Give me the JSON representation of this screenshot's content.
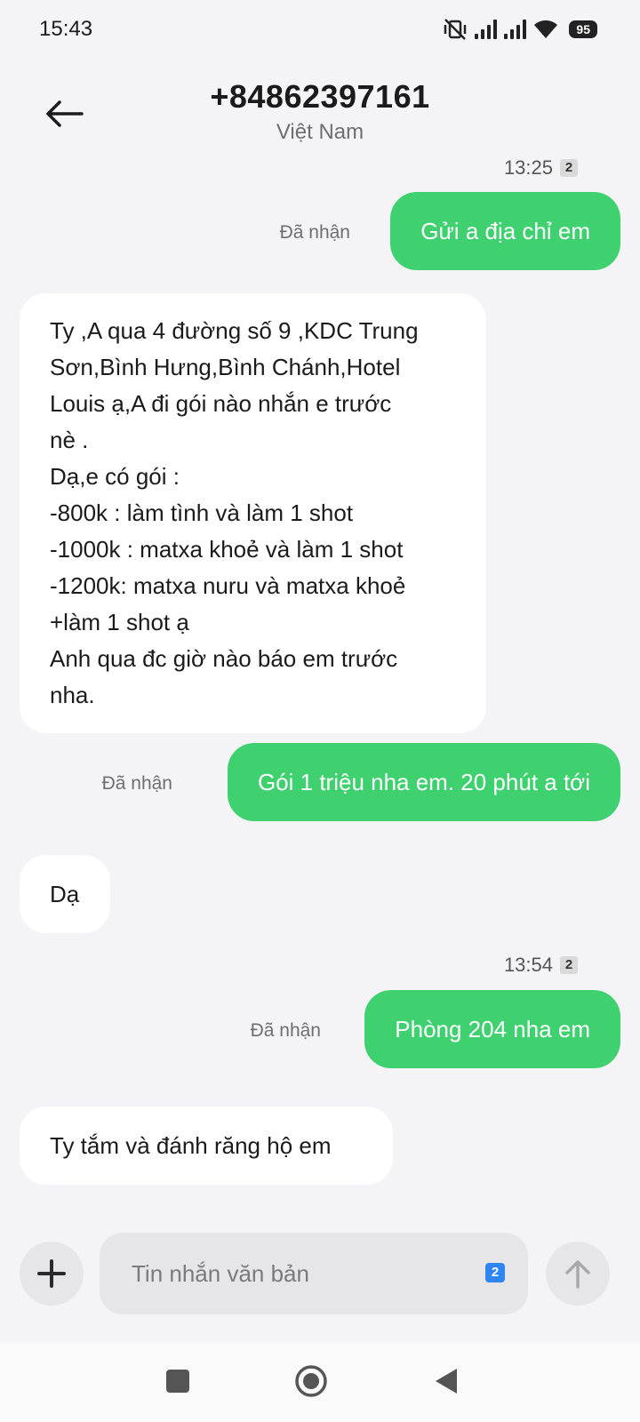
{
  "status_bar": {
    "time": "15:43",
    "battery": "95",
    "icons": [
      "mute-vibrate-icon",
      "signal-1-icon",
      "signal-2-icon",
      "wifi-icon",
      "battery-icon"
    ]
  },
  "header": {
    "back_icon": "arrow-left-icon",
    "phone": "+84862397161",
    "country": "Việt Nam"
  },
  "conversation": {
    "timestamp_1": {
      "time": "13:25",
      "sim": "2"
    },
    "msg_1": {
      "status": "Đã nhận",
      "text": "Gửi a địa chỉ em"
    },
    "msg_2": {
      "lines": [
        "Ty ,A qua 4 đường số 9 ,KDC Trung",
        "Sơn,Bình Hưng,Bình Chánh,Hotel",
        "Louis ạ,A đi gói nào nhắn e trước",
        "nè .",
        "Dạ,e có gói :",
        "-800k :  làm tình và làm 1 shot",
        "-1000k : matxa khoẻ và làm 1 shot",
        "-1200k: matxa nuru và matxa khoẻ",
        "+làm 1 shot  ạ",
        "Anh qua đc giờ nào báo em trước",
        "nha."
      ]
    },
    "msg_3": {
      "status": "Đã nhận",
      "text": "Gói 1 triệu nha em. 20 phút a tới"
    },
    "msg_4": {
      "text": "Dạ"
    },
    "timestamp_2": {
      "time": "13:54",
      "sim": "2"
    },
    "msg_5": {
      "status": "Đã nhận",
      "text": "Phòng 204 nha em"
    },
    "msg_6": {
      "text": "Ty tắm và đánh răng hộ em"
    }
  },
  "composer": {
    "placeholder": "Tin nhắn văn bản",
    "sim": "2",
    "add_icon": "plus-icon",
    "send_icon": "arrow-up-icon"
  },
  "navbar": {
    "icons": [
      "recents-square-icon",
      "home-circle-icon",
      "back-triangle-icon"
    ]
  },
  "colors": {
    "outgoing_bubble": "#3fd16f",
    "incoming_bubble": "#ffffff",
    "background": "#f4f4f6",
    "sim_badge": "#2f86f2"
  }
}
